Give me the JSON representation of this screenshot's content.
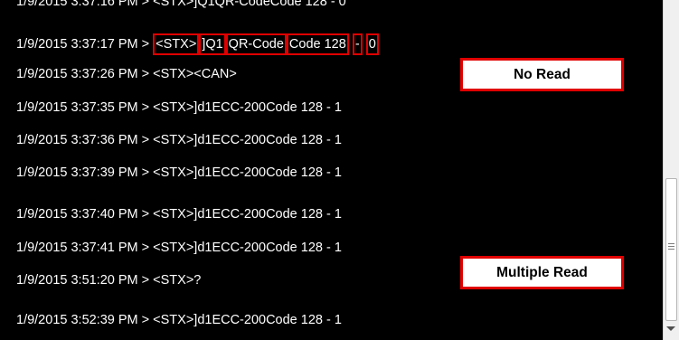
{
  "log": {
    "partial_line": "1/9/2015 3:37:16 PM > <STX>]Q1QR-CodeCode 128 - 0",
    "highlighted_line": {
      "prefix": "1/9/2015 3:37:17 PM > ",
      "segments": [
        "<STX>",
        "]Q1",
        "QR-Code",
        "Code 128",
        "-",
        "0"
      ],
      "separators": [
        "",
        "",
        "",
        " ",
        " "
      ]
    },
    "lines": [
      "1/9/2015 3:37:26 PM > <STX><CAN>",
      "1/9/2015 3:37:35 PM > <STX>]d1ECC-200Code 128 - 1",
      "1/9/2015 3:37:36 PM > <STX>]d1ECC-200Code 128 - 1",
      "1/9/2015 3:37:39 PM > <STX>]d1ECC-200Code 128 - 1",
      "1/9/2015 3:37:40 PM > <STX>]d1ECC-200Code 128 - 1",
      "1/9/2015 3:37:41 PM > <STX>]d1ECC-200Code 128 - 1",
      "1/9/2015 3:51:20 PM > <STX>?",
      "1/9/2015 3:52:39 PM > <STX>]d1ECC-200Code 128 - 1"
    ]
  },
  "callouts": {
    "no_read": "No Read",
    "multiple_read": "Multiple Read"
  },
  "colors": {
    "background": "#000000",
    "text": "#ffffff",
    "highlight": "#e00000"
  }
}
